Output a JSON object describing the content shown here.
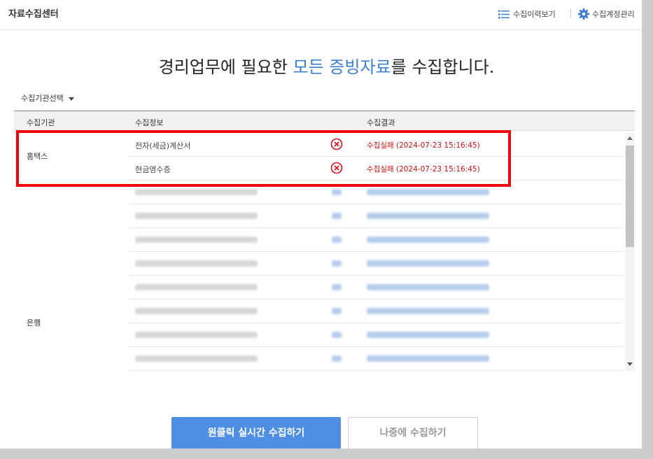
{
  "app": {
    "title": "자료수집센터"
  },
  "header": {
    "history_label": "수집이력보기",
    "history_icon": "list-icon",
    "account_label": "수집계정관리",
    "account_icon": "gear-icon"
  },
  "headline": {
    "part1": "경리업무에 필요한 ",
    "highlight": "모든 증빙자료",
    "part2": "를 수집합니다."
  },
  "filter": {
    "label": "수집기관선택"
  },
  "table": {
    "headers": {
      "org": "수집기관",
      "info": "수집정보",
      "result": "수집결과"
    },
    "orgs": {
      "hometax": "홈택스",
      "bank": "은행"
    },
    "rows": [
      {
        "info": "전자(세금)계산서",
        "status_icon": "error-circle-icon",
        "result": "수집실패 (2024-07-23 15:16:45)"
      },
      {
        "info": "현금영수증",
        "status_icon": "error-circle-icon",
        "result": "수집실패 (2024-07-23 15:16:45)"
      }
    ]
  },
  "buttons": {
    "collect_now": "원클릭 실시간 수집하기",
    "collect_later": "나중에 수집하기"
  },
  "colors": {
    "accent": "#3c7fd0",
    "primary_button": "#4f8fe3",
    "error": "#cc1111",
    "highlight_box": "#f00008"
  }
}
